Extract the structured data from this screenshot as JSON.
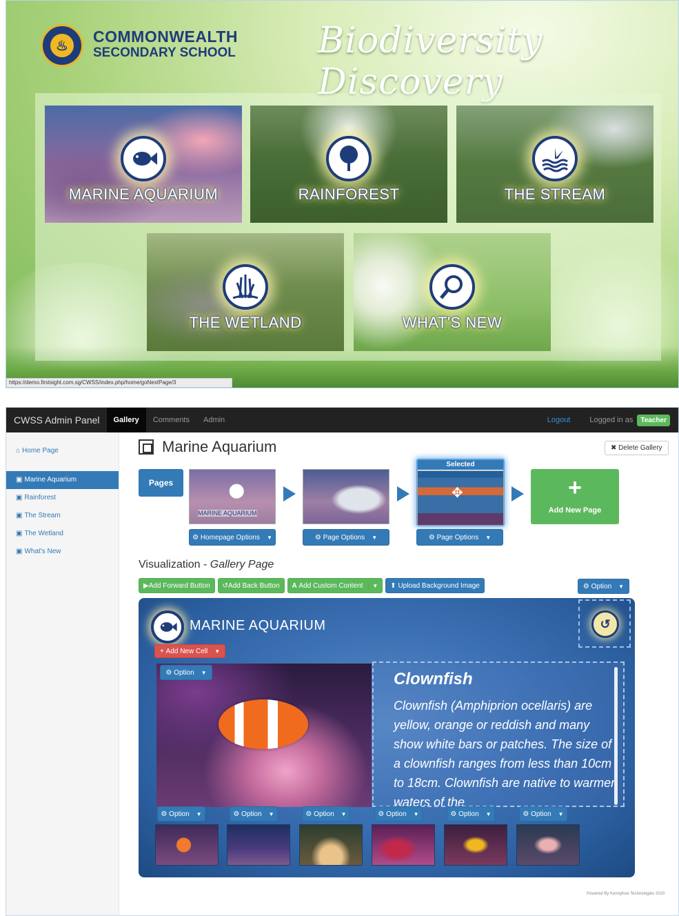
{
  "top": {
    "school_line1": "COMMONWEALTH",
    "school_line2": "SECONDARY SCHOOL",
    "title": "Biodiversity Discovery",
    "tiles": {
      "marine": "MARINE AQUARIUM",
      "rainforest": "RAINFOREST",
      "stream": "THE STREAM",
      "wetland": "THE WETLAND",
      "whatsnew": "WHAT'S NEW"
    },
    "status_url": "https://demo.firstsight.com.sg/CWSS/index.php/home/goNextPage/3"
  },
  "admin": {
    "brand": "CWSS Admin Panel",
    "nav": [
      "Gallery",
      "Comments",
      "Admin"
    ],
    "logout": "Logout",
    "logged_in": "Logged in as",
    "role": "Teacher",
    "sidebar": {
      "home": "Home Page",
      "items": [
        "Marine Aquarium",
        "Rainforest",
        "The Stream",
        "The Wetland",
        "What's New"
      ]
    },
    "page_title": "Marine Aquarium",
    "delete_gallery": "Delete Gallery",
    "pages_label": "Pages",
    "selected_label": "Selected",
    "thumb_label": "MARINE AQUARIUM",
    "homepage_options": "Homepage Options",
    "page_options": "Page Options",
    "add_new_page": "Add New Page",
    "viz_prefix": "Visualization - ",
    "viz_name": "Gallery Page",
    "buttons": {
      "forward": "Add Forward Button",
      "back": "Add Back Button",
      "custom": "Add Custom Content",
      "upload": "Upload Background Image"
    },
    "option": "Option",
    "canvas_title": "MARINE AQUARIUM",
    "add_new_cell": "Add New Cell",
    "fish_title": "Clownfish",
    "fish_desc": "Clownfish (Amphiprion ocellaris) are yellow, orange or reddish and many show white bars or patches. The size of a clownfish ranges from less than 10cm to 18cm. Clownfish are native to warmer waters of the",
    "footer": "Powered By KennyKee Technologies 2020"
  }
}
